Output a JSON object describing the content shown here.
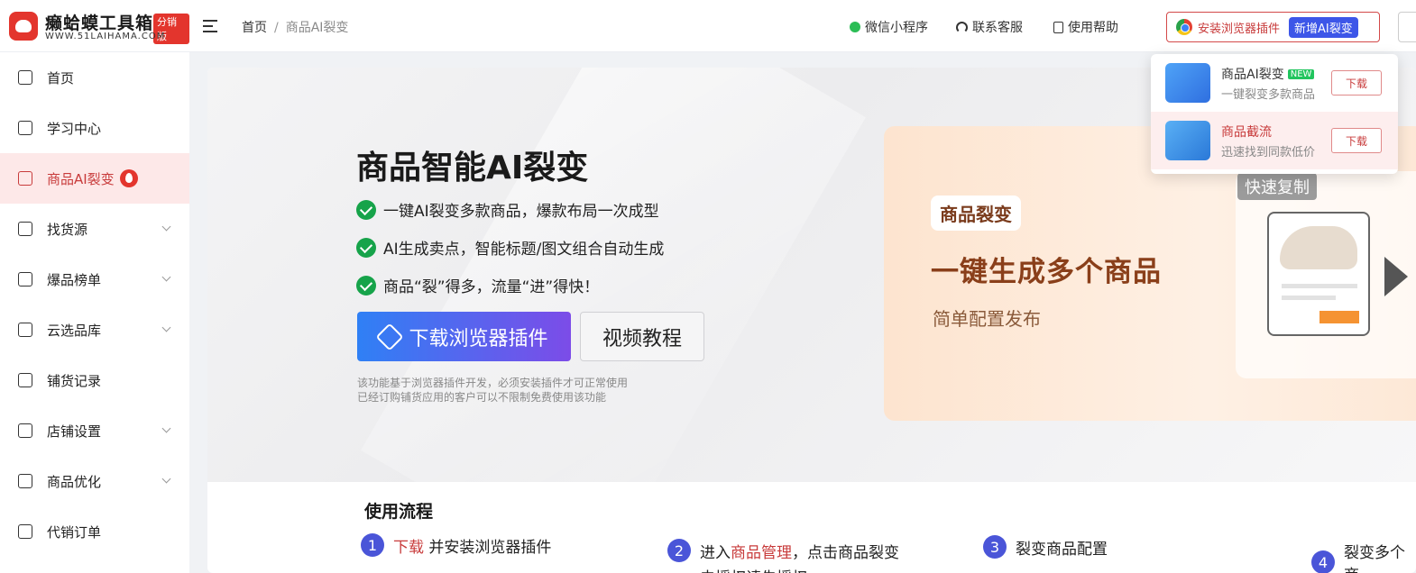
{
  "header": {
    "logo_title": "癞蛤蟆工具箱",
    "logo_badge": "分销版",
    "logo_subtitle": "WWW.51LAIHAMA.COM",
    "breadcrumb": [
      "首页",
      "商品AI裂变"
    ],
    "links": [
      "微信小程序",
      "联系客服",
      "使用帮助"
    ],
    "install_label": "安装浏览器插件",
    "install_tag": "新增AI裂变"
  },
  "sidebar": {
    "items": [
      {
        "label": "首页"
      },
      {
        "label": "学习中心"
      },
      {
        "label": "商品AI裂变"
      },
      {
        "label": "找货源"
      },
      {
        "label": "爆品榜单"
      },
      {
        "label": "云选品库"
      },
      {
        "label": "铺货记录"
      },
      {
        "label": "店铺设置"
      },
      {
        "label": "商品优化"
      },
      {
        "label": "代销订单"
      }
    ]
  },
  "hero": {
    "title": "商品智能AI裂变",
    "features": [
      "一键AI裂变多款商品，爆款布局一次成型",
      "AI生成卖点，智能标题/图文组合自动生成",
      "商品“裂”得多，流量“进”得快！"
    ],
    "download_label": "下载浏览器插件",
    "video_label": "视频教程",
    "note_line1": "该功能基于浏览器插件开发，必须安装插件才可正常使用",
    "note_line2": "已经订购铺货应用的客户可以不限制免费使用该功能"
  },
  "banner": {
    "tag": "商品裂变",
    "title": "一键生成多个商品",
    "subtitle": "简单配置发布",
    "copy_tag": "快速复制"
  },
  "process": {
    "title": "使用流程",
    "steps": [
      {
        "num": "1",
        "link": "下载",
        "text": "并安装浏览器插件"
      },
      {
        "num": "2",
        "pre": "进入",
        "link": "商品管理",
        "text": "，点击商品裂变",
        "cont": "去授权请先授权"
      },
      {
        "num": "3",
        "text": "裂变商品配置"
      },
      {
        "num": "4",
        "text": "裂变多个商"
      }
    ]
  },
  "dropdown": {
    "items": [
      {
        "title": "商品AI裂变",
        "badge": "NEW",
        "desc": "一键裂变多款商品",
        "button": "下载"
      },
      {
        "title": "商品截流",
        "desc": "迅速找到同款低价",
        "button": "下载"
      }
    ]
  }
}
